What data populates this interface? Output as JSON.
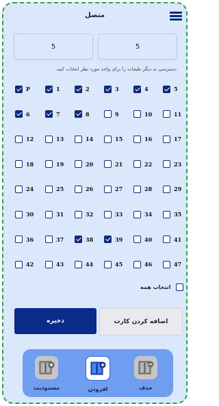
{
  "header": {
    "title": "متصل",
    "menu_icon": "hamburger-menu-icon"
  },
  "fields": {
    "left_value": "5",
    "right_value": "5"
  },
  "hint": "دسترسی به دیگر طبقات را برای واحد مورد نظر انتخاب کنید.",
  "floors": [
    {
      "label": "P",
      "checked": true
    },
    {
      "label": "1",
      "checked": true
    },
    {
      "label": "2",
      "checked": true
    },
    {
      "label": "3",
      "checked": true
    },
    {
      "label": "4",
      "checked": true
    },
    {
      "label": "5",
      "checked": true
    },
    {
      "label": "6",
      "checked": true
    },
    {
      "label": "7",
      "checked": true
    },
    {
      "label": "8",
      "checked": true
    },
    {
      "label": "9",
      "checked": false
    },
    {
      "label": "10",
      "checked": false
    },
    {
      "label": "11",
      "checked": false
    },
    {
      "label": "12",
      "checked": false
    },
    {
      "label": "13",
      "checked": false
    },
    {
      "label": "14",
      "checked": false
    },
    {
      "label": "15",
      "checked": false
    },
    {
      "label": "16",
      "checked": false
    },
    {
      "label": "17",
      "checked": false
    },
    {
      "label": "18",
      "checked": false
    },
    {
      "label": "19",
      "checked": false
    },
    {
      "label": "20",
      "checked": false
    },
    {
      "label": "21",
      "checked": false
    },
    {
      "label": "22",
      "checked": false
    },
    {
      "label": "23",
      "checked": false
    },
    {
      "label": "24",
      "checked": false
    },
    {
      "label": "25",
      "checked": false
    },
    {
      "label": "26",
      "checked": false
    },
    {
      "label": "27",
      "checked": false
    },
    {
      "label": "28",
      "checked": false
    },
    {
      "label": "29",
      "checked": false
    },
    {
      "label": "30",
      "checked": false
    },
    {
      "label": "31",
      "checked": false
    },
    {
      "label": "32",
      "checked": false
    },
    {
      "label": "33",
      "checked": false
    },
    {
      "label": "34",
      "checked": false
    },
    {
      "label": "35",
      "checked": false
    },
    {
      "label": "36",
      "checked": false
    },
    {
      "label": "37",
      "checked": false
    },
    {
      "label": "38",
      "checked": true
    },
    {
      "label": "39",
      "checked": true
    },
    {
      "label": "40",
      "checked": false
    },
    {
      "label": "41",
      "checked": false
    },
    {
      "label": "42",
      "checked": false
    },
    {
      "label": "43",
      "checked": false
    },
    {
      "label": "44",
      "checked": false
    },
    {
      "label": "45",
      "checked": false
    },
    {
      "label": "46",
      "checked": false
    },
    {
      "label": "47",
      "checked": false
    }
  ],
  "select_all": {
    "label": "انتخاب همه",
    "checked": false
  },
  "buttons": {
    "save": "ذخیره",
    "add_card": "اضافه کردن کارت"
  },
  "bottom_nav": {
    "block": {
      "label": "مسدودیت",
      "icon": "elevator-lock-icon"
    },
    "add": {
      "label": "افزودن",
      "icon": "elevator-add-icon"
    },
    "delete": {
      "label": "حذف",
      "icon": "elevator-remove-icon"
    }
  },
  "colors": {
    "accent": "#0b2a8a",
    "nav_bg": "#6f9df0",
    "frame": "#2aa44a",
    "bg": "#dbe8fb"
  }
}
